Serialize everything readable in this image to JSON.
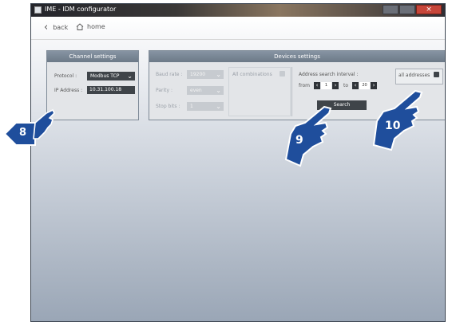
{
  "window": {
    "title": "IME - IDM configurator"
  },
  "nav": {
    "back_label": "back",
    "home_label": "home"
  },
  "channel": {
    "header": "Channel settings",
    "protocol_label": "Protocol :",
    "protocol_value": "Modbus TCP",
    "ip_label": "IP Address :",
    "ip_value": "10.31.100.18"
  },
  "devices": {
    "header": "Devices settings",
    "baud_label": "Baud rate :",
    "baud_value": "19200",
    "parity_label": "Parity :",
    "parity_value": "even",
    "stop_label": "Stop bits :",
    "stop_value": "1",
    "all_combinations_label": "All combinations",
    "interval_label": "Address search interval :",
    "from_label": "from",
    "from_value": "1",
    "to_label": "to",
    "to_value": "20",
    "all_addresses_label": "all addresses",
    "search_label": "Search"
  },
  "callouts": {
    "c8": "8",
    "c9": "9",
    "c10": "10"
  },
  "colors": {
    "callout_blue": "#1f4e9c",
    "panel_dark": "#3f4449"
  }
}
